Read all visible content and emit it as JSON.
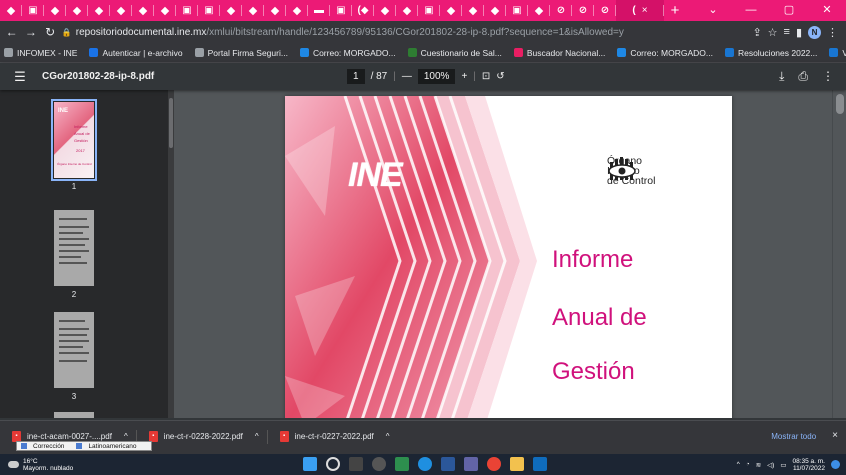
{
  "colors": {
    "tab_strip": "#ec1a76",
    "chrome_dark": "#35363a",
    "pdf_bar": "#323639",
    "viewer_bg": "#525659",
    "title_magenta": "#d0117c",
    "taskbar": "#1c2533"
  },
  "tabs": {
    "active_close": "×",
    "new_tab": "+"
  },
  "window": {
    "minimize": "⌄",
    "min2": "—",
    "max": "▢",
    "close": "✕"
  },
  "address": {
    "host": "repositoriodocumental.ine.mx",
    "path": "/xmlui/bitstream/handle/123456789/95136/CGor201802-28-ip-8.pdf?sequence=1&isAllowed=y",
    "profile_initial": "N"
  },
  "bookmarks": [
    {
      "label": "INFOMEX - INE",
      "color": "#9aa0a6"
    },
    {
      "label": "Autenticar | e-archivo",
      "color": "#1a73e8"
    },
    {
      "label": "Portal Firma Seguri...",
      "color": "#9aa0a6"
    },
    {
      "label": "Correo: MORGADO...",
      "color": "#1e88e5"
    },
    {
      "label": "Cuestionario de Sal...",
      "color": "#2e7d32"
    },
    {
      "label": "Buscador Nacional...",
      "color": "#e91e63"
    },
    {
      "label": "Correo: MORGADO...",
      "color": "#1e88e5"
    },
    {
      "label": "Resoluciones 2022...",
      "color": "#1976d2"
    },
    {
      "label": "VP y respuestas - O...",
      "color": "#1976d2"
    },
    {
      "label": "Resoluciones 2019...",
      "color": "#1976d2"
    }
  ],
  "pdf": {
    "title": "CGor201802-28-ip-8.pdf",
    "page_current": "1",
    "page_total": "/ 87",
    "zoom": "100%",
    "minus": "—",
    "plus": "+"
  },
  "thumbnails": [
    {
      "num": "1"
    },
    {
      "num": "2"
    },
    {
      "num": "3"
    }
  ],
  "thumb1": {
    "lines": [
      "Informe",
      "Anual de",
      "Gestión",
      "2017"
    ],
    "sub": "Órgano Interno de Control",
    "logo": "INE"
  },
  "page": {
    "logo": "INE",
    "oic_lines": [
      "Órgano",
      "Interno",
      "de Control"
    ],
    "title_lines": [
      "Informe",
      "Anual de",
      "Gestión"
    ]
  },
  "downloads": [
    {
      "name": "ine-ct-acam-0027-....pdf",
      "chev": "^"
    },
    {
      "name": "ine-ct-r-0228-2022.pdf",
      "chev": "^"
    },
    {
      "name": "ine-ct-r-0227-2022.pdf",
      "chev": "^"
    }
  ],
  "shelf": {
    "show_all": "Mostrar todo",
    "close": "×"
  },
  "popup": {
    "items": [
      "Corrección",
      "Latinoamericano"
    ]
  },
  "weather": {
    "temp": "16°C",
    "desc": "Mayorm. nublado"
  },
  "clock": {
    "time": "08:35 a. m.",
    "date": "11/07/2022"
  }
}
